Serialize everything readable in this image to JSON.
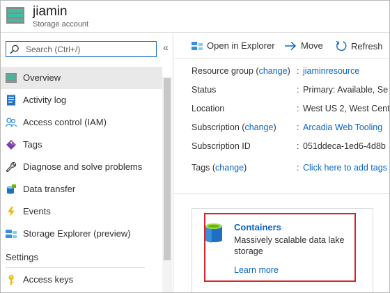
{
  "header": {
    "title": "jiamin",
    "subtitle": "Storage account"
  },
  "sidebar": {
    "search_placeholder": "Search (Ctrl+/)",
    "collapse_glyph": "«",
    "items": [
      {
        "label": "Overview",
        "icon": "overview-icon",
        "active": true
      },
      {
        "label": "Activity log",
        "icon": "activity-log-icon"
      },
      {
        "label": "Access control (IAM)",
        "icon": "access-control-icon"
      },
      {
        "label": "Tags",
        "icon": "tag-icon"
      },
      {
        "label": "Diagnose and solve problems",
        "icon": "wrench-icon"
      },
      {
        "label": "Data transfer",
        "icon": "data-transfer-icon"
      },
      {
        "label": "Events",
        "icon": "lightning-icon"
      },
      {
        "label": "Storage Explorer (preview)",
        "icon": "storage-explorer-icon"
      }
    ],
    "section_settings": "Settings",
    "settings_items": [
      {
        "label": "Access keys",
        "icon": "key-icon"
      }
    ]
  },
  "toolbar": {
    "open_explorer": "Open in Explorer",
    "move": "Move",
    "refresh": "Refresh"
  },
  "properties": {
    "resource_group_label": "Resource group (",
    "resource_group_change": "change",
    "resource_group_close": ")",
    "resource_group_value": "jiaminresource",
    "status_label": "Status",
    "status_value": "Primary: Available, Se",
    "location_label": "Location",
    "location_value": "West US 2, West Centr",
    "subscription_label": "Subscription (",
    "subscription_change": "change",
    "subscription_close": ")",
    "subscription_value": "Arcadia Web Tooling",
    "subscription_id_label": "Subscription ID",
    "subscription_id_value": "051ddeca-1ed6-4d8b",
    "tags_label": "Tags (",
    "tags_change": "change",
    "tags_close": ")",
    "tags_value": "Click here to add tags",
    "colon": ":"
  },
  "card": {
    "title": "Containers",
    "description": "Massively scalable data lake storage",
    "link": "Learn more"
  },
  "colors": {
    "accent": "#0b66c4",
    "highlight": "#d9232a",
    "active_bg": "#e9e9e9"
  }
}
